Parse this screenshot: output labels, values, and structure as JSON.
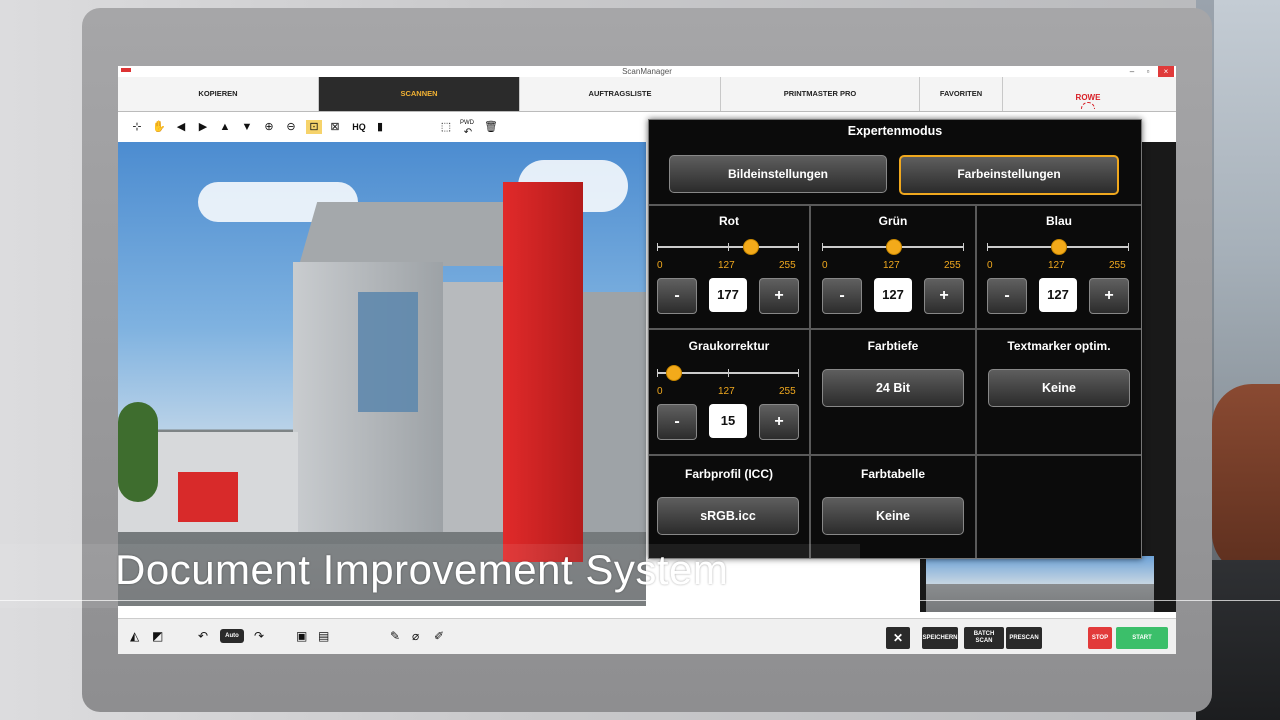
{
  "window": {
    "title": "ScanManager"
  },
  "tabs": [
    "KOPIEREN",
    "SCANNEN",
    "AUFTRAGSLISTE",
    "PRINTMASTER PRO",
    "FAVORITEN"
  ],
  "active_tab": "SCANNEN",
  "logo": {
    "text": "ROWE"
  },
  "toolbar": {
    "hq_label": "HQ",
    "pwd_label": "PWD"
  },
  "expert_panel": {
    "title": "Expertenmodus",
    "mode_buttons": [
      "Bildeinstellungen",
      "Farbeinstellungen"
    ],
    "selected_mode": "Farbeinstellungen",
    "channels": [
      {
        "label": "Rot",
        "min": "0",
        "mid": "127",
        "max": "255",
        "value": "177",
        "minus": "-",
        "plus": "+"
      },
      {
        "label": "Grün",
        "min": "0",
        "mid": "127",
        "max": "255",
        "value": "127",
        "minus": "-",
        "plus": "+"
      },
      {
        "label": "Blau",
        "min": "0",
        "mid": "127",
        "max": "255",
        "value": "127",
        "minus": "-",
        "plus": "+"
      }
    ],
    "gray": {
      "label": "Graukorrektur",
      "min": "0",
      "mid": "127",
      "max": "255",
      "value": "15",
      "minus": "-",
      "plus": "+"
    },
    "farbtiefe": {
      "label": "Farbtiefe",
      "value": "24 Bit"
    },
    "textmarker": {
      "label": "Textmarker optim.",
      "value": "Keine"
    },
    "farbprofil": {
      "label": "Farbprofil (ICC)",
      "value": "sRGB.icc"
    },
    "farbtabelle": {
      "label": "Farbtabelle",
      "value": "Keine"
    }
  },
  "bottom": {
    "auto_label": "Auto",
    "speichern": "SPEICHERN",
    "batch_scan": "BATCH SCAN",
    "prescan": "PRESCAN",
    "stop": "STOP",
    "start": "START"
  },
  "caption": "Document Improvement System",
  "colors": {
    "accent": "#f0a81e",
    "brand": "#d81f26",
    "stop": "#e23a3a",
    "start": "#3bbf6a"
  }
}
